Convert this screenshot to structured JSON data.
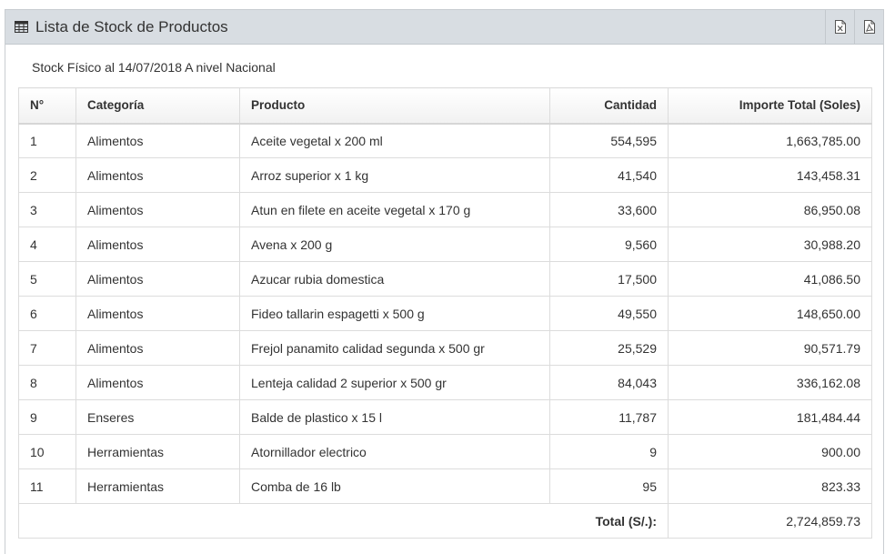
{
  "panel": {
    "title": "Lista de Stock de Productos",
    "actions": [
      {
        "name": "excel-export",
        "icon": "excel-file-icon"
      },
      {
        "name": "pdf-export",
        "icon": "pdf-file-icon"
      }
    ]
  },
  "subtitle": "Stock Físico al 14/07/2018 A nivel Nacional",
  "table": {
    "columns": [
      "N°",
      "Categoría",
      "Producto",
      "Cantidad",
      "Importe Total (Soles)"
    ],
    "rows": [
      [
        "1",
        "Alimentos",
        "Aceite vegetal x 200 ml",
        "554,595",
        "1,663,785.00"
      ],
      [
        "2",
        "Alimentos",
        "Arroz superior x 1 kg",
        "41,540",
        "143,458.31"
      ],
      [
        "3",
        "Alimentos",
        "Atun en filete en aceite vegetal x 170 g",
        "33,600",
        "86,950.08"
      ],
      [
        "4",
        "Alimentos",
        "Avena x 200 g",
        "9,560",
        "30,988.20"
      ],
      [
        "5",
        "Alimentos",
        "Azucar rubia domestica",
        "17,500",
        "41,086.50"
      ],
      [
        "6",
        "Alimentos",
        "Fideo tallarin espagetti x 500 g",
        "49,550",
        "148,650.00"
      ],
      [
        "7",
        "Alimentos",
        "Frejol panamito calidad segunda x 500 gr",
        "25,529",
        "90,571.79"
      ],
      [
        "8",
        "Alimentos",
        "Lenteja calidad 2 superior x 500 gr",
        "84,043",
        "336,162.08"
      ],
      [
        "9",
        "Enseres",
        "Balde de plastico x 15 l",
        "11,787",
        "181,484.44"
      ],
      [
        "10",
        "Herramientas",
        "Atornillador electrico",
        "9",
        "900.00"
      ],
      [
        "11",
        "Herramientas",
        "Comba de 16 lb",
        "95",
        "823.33"
      ]
    ],
    "total": {
      "label": "Total (S/.):",
      "value": "2,724,859.73"
    }
  }
}
